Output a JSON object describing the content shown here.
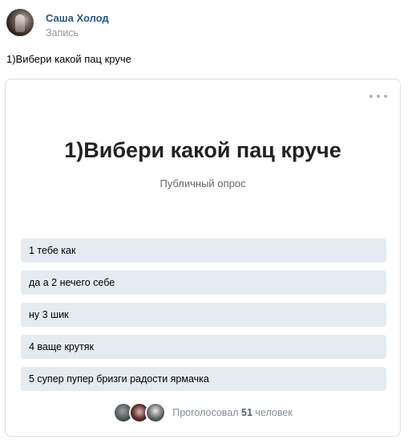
{
  "post": {
    "author_name": "Саша Холод",
    "post_type": "Запись",
    "text": "1)Вибери какой пац круче"
  },
  "poll": {
    "more_icon": "more-horizontal-icon",
    "title": "1)Вибери какой пац круче",
    "subtitle": "Публичный опрос",
    "options": [
      "1 тебе как",
      "да а 2 нечего себе",
      "ну 3 шик",
      "4 ваще крутяк",
      "5 супер пупер бризги радости ярмачка"
    ],
    "voters": {
      "prefix": "Проголосовал",
      "count": "51",
      "suffix": "человек"
    }
  },
  "colors": {
    "link": "#2a5885",
    "option_bg": "#e5ebf1",
    "card_border": "#dce1e6",
    "muted": "#818c99"
  }
}
